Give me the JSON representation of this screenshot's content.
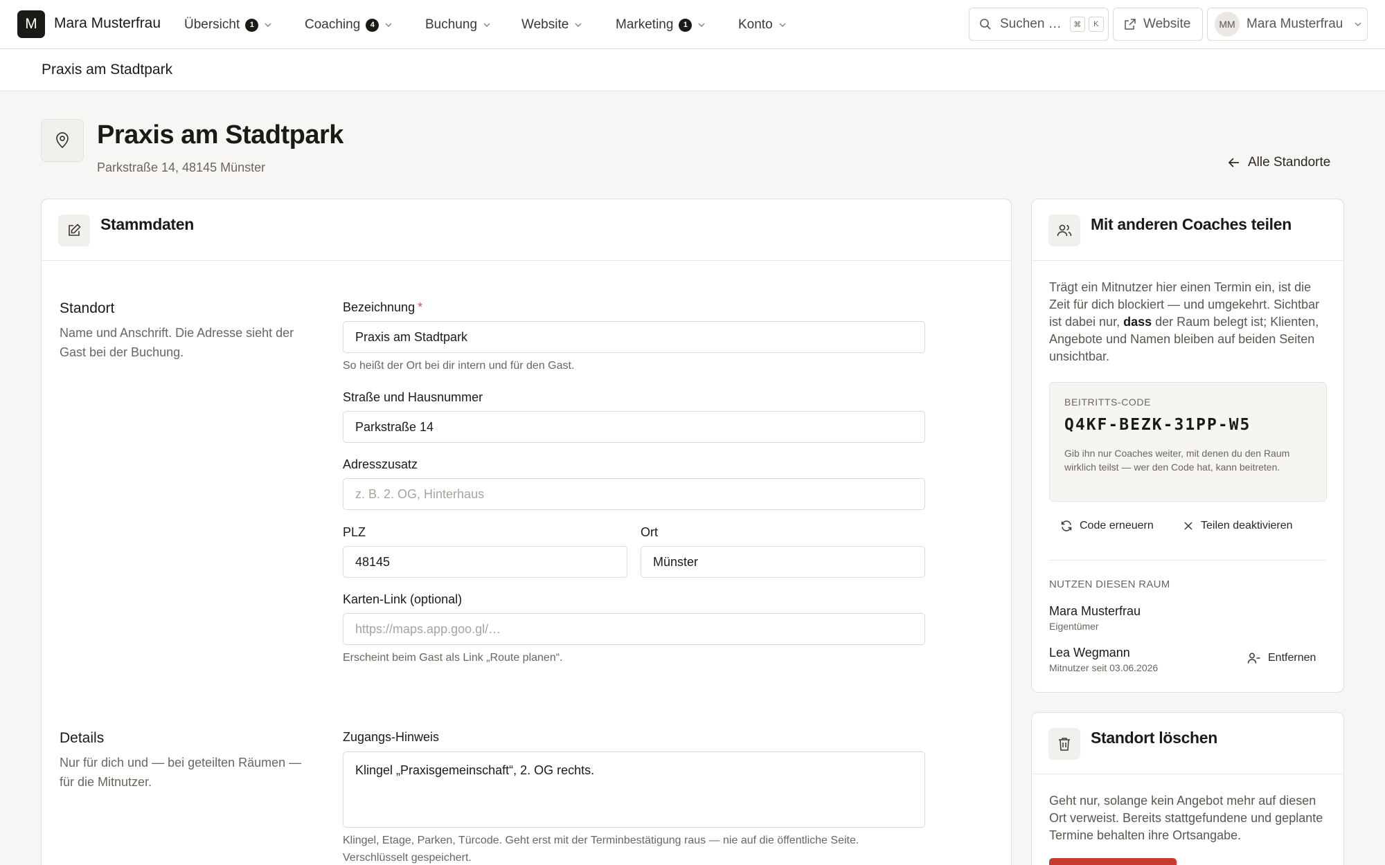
{
  "nav": {
    "brand_initial": "M",
    "brand_name": "Mara Musterfrau",
    "items": [
      {
        "label": "Übersicht",
        "badge": "1"
      },
      {
        "label": "Coaching",
        "badge": "4"
      },
      {
        "label": "Buchung",
        "badge": ""
      },
      {
        "label": "Website",
        "badge": ""
      },
      {
        "label": "Marketing",
        "badge": "1"
      },
      {
        "label": "Konto",
        "badge": ""
      }
    ],
    "search_label": "Suchen …",
    "shortcut_keys": [
      "⌘",
      "K"
    ],
    "website_button": "Website",
    "user_initials": "MM",
    "user_name": "Mara Musterfrau"
  },
  "breadcrumb": "Praxis am Stadtpark",
  "header": {
    "title": "Praxis am Stadtpark",
    "subtitle": "Parkstraße 14, 48145 Münster",
    "back_link": "Alle Standorte"
  },
  "stammdaten": {
    "title": "Stammdaten",
    "standort": {
      "title": "Standort",
      "description": "Name und Anschrift. Die Adresse sieht der Gast bei der Buchung."
    },
    "fields": {
      "bezeichnung_label": "Bezeichnung",
      "bezeichnung_required": "*",
      "bezeichnung_value": "Praxis am Stadtpark",
      "bezeichnung_hint": "So heißt der Ort bei dir intern und für den Gast.",
      "strasse_label": "Straße und Hausnummer",
      "strasse_value": "Parkstraße 14",
      "zusatz_label": "Adresszusatz",
      "zusatz_placeholder": "z. B. 2. OG, Hinterhaus",
      "plz_label": "PLZ",
      "plz_value": "48145",
      "ort_label": "Ort",
      "ort_value": "Münster",
      "karte_label": "Karten-Link (optional)",
      "karte_placeholder": "https://maps.app.goo.gl/…",
      "karte_hint": "Erscheint beim Gast als Link „Route planen“."
    },
    "details": {
      "title": "Details",
      "description": "Nur für dich und — bei geteilten Räumen — für die Mitnutzer.",
      "zugang_label": "Zugangs-Hinweis",
      "zugang_value": "Klingel „Praxisgemeinschaft“, 2. OG rechts.",
      "zugang_hint": "Klingel, Etage, Parken, Türcode. Geht erst mit der Terminbestätigung raus — nie auf die öffentliche Seite. Verschlüsselt gespeichert."
    }
  },
  "share": {
    "title": "Mit anderen Coaches teilen",
    "text_before": "Trägt ein Mitnutzer hier einen Termin ein, ist die Zeit für dich blockiert — und umgekehrt. Sichtbar ist dabei nur,",
    "text_bold": "dass",
    "text_after": "der Raum belegt ist; Klienten, Angebote und Namen bleiben auf beiden Seiten unsichtbar.",
    "code_label": "BEITRITTS-CODE",
    "code_value": "Q4KF-BEZK-31PP-W5",
    "code_hint": "Gib ihn nur Coaches weiter, mit denen du den Raum wirklich teilst — wer den Code hat, kann beitreten.",
    "renew_label": "Code erneuern",
    "disable_label": "Teilen deaktivieren",
    "users_heading": "NUTZEN DIESEN RAUM",
    "users": [
      {
        "name": "Mara Musterfrau",
        "role": "Eigentümer"
      },
      {
        "name": "Lea Wegmann",
        "role": "Mitnutzer seit 03.06.2026"
      }
    ],
    "remove_label": "Entfernen"
  },
  "delete": {
    "title": "Standort löschen",
    "text": "Geht nur, solange kein Angebot mehr auf diesen Ort verweist. Bereits stattgefundene und geplante Termine behalten ihre Ortsangabe."
  },
  "colors": {
    "background": "#f7f6f4",
    "text": "#1c1a17",
    "muted": "#6a665f",
    "border": "#e3e0db",
    "danger": "#c8392f"
  },
  "icons": [
    "chevron-down-icon",
    "search-icon",
    "external-link-icon",
    "map-pin-icon",
    "arrow-left-icon",
    "edit-icon",
    "users-icon",
    "refresh-icon",
    "close-icon",
    "user-minus-icon",
    "trash-icon"
  ]
}
